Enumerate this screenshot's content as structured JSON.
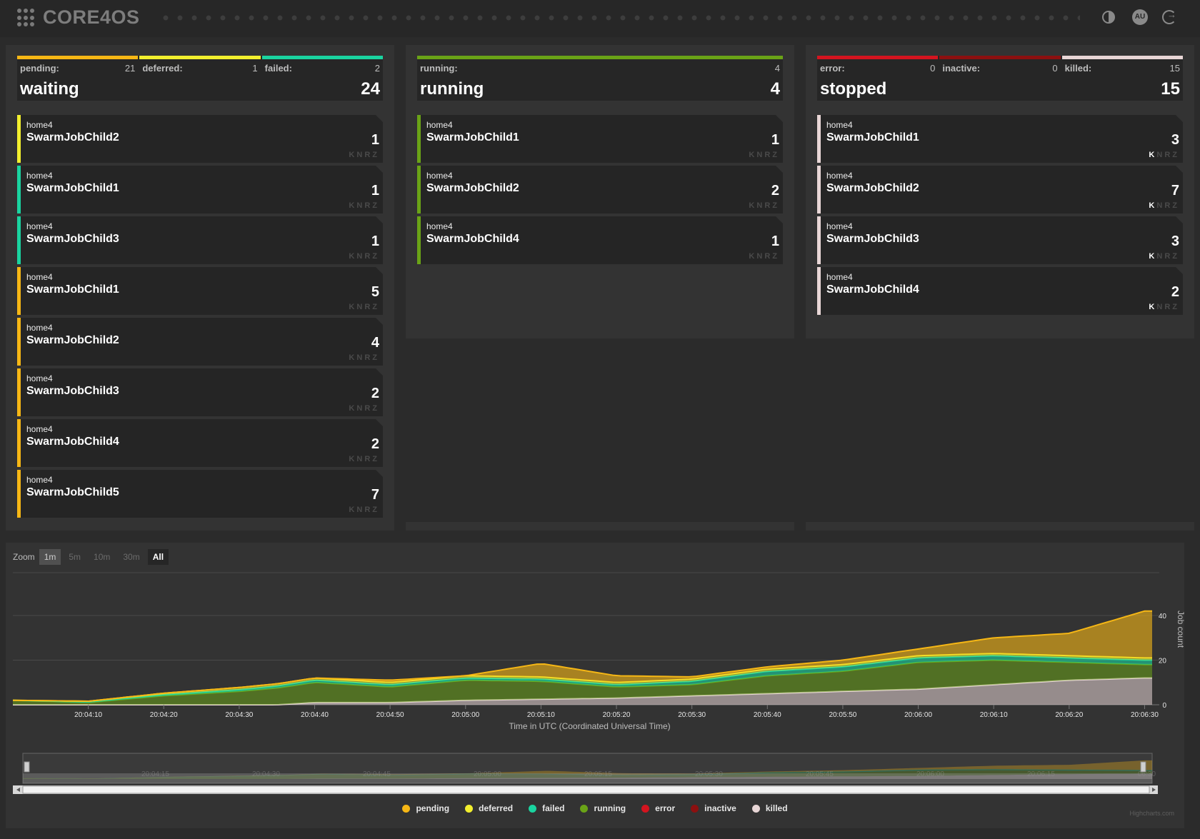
{
  "header": {
    "logo": "CORE4OS",
    "avatar_initials": "AU"
  },
  "panels": {
    "waiting": {
      "label": "waiting",
      "total": "24",
      "subs": [
        {
          "name": "pending:",
          "count": "21",
          "color": "#f6b715"
        },
        {
          "name": "deferred:",
          "count": "1",
          "color": "#f2ef2e"
        },
        {
          "name": "failed:",
          "count": "2",
          "color": "#1ad4a0"
        }
      ],
      "jobs": [
        {
          "host": "home4",
          "name": "SwarmJobChild2",
          "count": "1",
          "color": "#f2ef2e",
          "flags": [
            "K",
            "N",
            "R",
            "Z"
          ],
          "killed": false
        },
        {
          "host": "home4",
          "name": "SwarmJobChild1",
          "count": "1",
          "color": "#1ad4a0",
          "flags": [
            "K",
            "N",
            "R",
            "Z"
          ],
          "killed": false
        },
        {
          "host": "home4",
          "name": "SwarmJobChild3",
          "count": "1",
          "color": "#1ad4a0",
          "flags": [
            "K",
            "N",
            "R",
            "Z"
          ],
          "killed": false
        },
        {
          "host": "home4",
          "name": "SwarmJobChild1",
          "count": "5",
          "color": "#f6b715",
          "flags": [
            "K",
            "N",
            "R",
            "Z"
          ],
          "killed": false
        },
        {
          "host": "home4",
          "name": "SwarmJobChild2",
          "count": "4",
          "color": "#f6b715",
          "flags": [
            "K",
            "N",
            "R",
            "Z"
          ],
          "killed": false
        },
        {
          "host": "home4",
          "name": "SwarmJobChild3",
          "count": "2",
          "color": "#f6b715",
          "flags": [
            "K",
            "N",
            "R",
            "Z"
          ],
          "killed": false
        },
        {
          "host": "home4",
          "name": "SwarmJobChild4",
          "count": "2",
          "color": "#f6b715",
          "flags": [
            "K",
            "N",
            "R",
            "Z"
          ],
          "killed": false
        },
        {
          "host": "home4",
          "name": "SwarmJobChild5",
          "count": "7",
          "color": "#f6b715",
          "flags": [
            "K",
            "N",
            "R",
            "Z"
          ],
          "killed": false
        }
      ]
    },
    "running": {
      "label": "running",
      "total": "4",
      "subs": [
        {
          "name": "running:",
          "count": "4",
          "color": "#6aa317"
        }
      ],
      "jobs": [
        {
          "host": "home4",
          "name": "SwarmJobChild1",
          "count": "1",
          "color": "#6aa317",
          "flags": [
            "K",
            "N",
            "R",
            "Z"
          ],
          "killed": false
        },
        {
          "host": "home4",
          "name": "SwarmJobChild2",
          "count": "2",
          "color": "#6aa317",
          "flags": [
            "K",
            "N",
            "R",
            "Z"
          ],
          "killed": false
        },
        {
          "host": "home4",
          "name": "SwarmJobChild4",
          "count": "1",
          "color": "#6aa317",
          "flags": [
            "K",
            "N",
            "R",
            "Z"
          ],
          "killed": false
        }
      ]
    },
    "stopped": {
      "label": "stopped",
      "total": "15",
      "subs": [
        {
          "name": "error:",
          "count": "0",
          "color": "#d4141f"
        },
        {
          "name": "inactive:",
          "count": "0",
          "color": "#8c1010"
        },
        {
          "name": "killed:",
          "count": "15",
          "color": "#e8d6d6"
        }
      ],
      "jobs": [
        {
          "host": "home4",
          "name": "SwarmJobChild1",
          "count": "3",
          "color": "#e8d6d6",
          "flags": [
            "K",
            "N",
            "R",
            "Z"
          ],
          "killed": true
        },
        {
          "host": "home4",
          "name": "SwarmJobChild2",
          "count": "7",
          "color": "#e8d6d6",
          "flags": [
            "K",
            "N",
            "R",
            "Z"
          ],
          "killed": true
        },
        {
          "host": "home4",
          "name": "SwarmJobChild3",
          "count": "3",
          "color": "#e8d6d6",
          "flags": [
            "K",
            "N",
            "R",
            "Z"
          ],
          "killed": true
        },
        {
          "host": "home4",
          "name": "SwarmJobChild4",
          "count": "2",
          "color": "#e8d6d6",
          "flags": [
            "K",
            "N",
            "R",
            "Z"
          ],
          "killed": true
        }
      ]
    }
  },
  "chart": {
    "zoom_label": "Zoom",
    "zoom_buttons": [
      "1m",
      "5m",
      "10m",
      "30m",
      "All"
    ],
    "credits": "Highcharts.com"
  },
  "chart_data": {
    "type": "area",
    "stacked": true,
    "xlabel": "Time in UTC (Coordinated Universal Time)",
    "ylabel": "Job count",
    "ylim": [
      0,
      40
    ],
    "y_ticks": [
      "0",
      "20",
      "40"
    ],
    "x_ticks": [
      "20:04:10",
      "20:04:20",
      "20:04:30",
      "20:04:40",
      "20:04:50",
      "20:05:00",
      "20:05:10",
      "20:05:20",
      "20:05:30",
      "20:05:40",
      "20:05:50",
      "20:06:00",
      "20:06:10",
      "20:06:20",
      "20:06:30"
    ],
    "navigator_ticks": [
      "20:04:15",
      "20:04:30",
      "20:04:45",
      "20:05:00",
      "20:05:15",
      "20:05:30",
      "20:05:45",
      "20:06:00",
      "20:06:15",
      "06:30"
    ],
    "x_range": [
      "20:04:00",
      "20:06:31"
    ],
    "legend_position": "bottom",
    "series": [
      {
        "name": "killed",
        "color": "#e8d6d6",
        "x": [
          "20:04:00",
          "20:04:35",
          "20:04:40",
          "20:04:50",
          "20:05:00",
          "20:05:20",
          "20:05:30",
          "20:05:40",
          "20:05:50",
          "20:06:00",
          "20:06:10",
          "20:06:20",
          "20:06:30"
        ],
        "values": [
          0,
          0,
          1,
          1,
          2,
          3,
          4,
          5,
          6,
          7,
          9,
          11,
          12
        ]
      },
      {
        "name": "running",
        "color": "#6aa317",
        "x": [
          "20:04:00",
          "20:04:10",
          "20:04:20",
          "20:04:30",
          "20:04:40",
          "20:04:50",
          "20:05:00",
          "20:05:10",
          "20:05:20",
          "20:05:30",
          "20:05:40",
          "20:05:50",
          "20:06:00",
          "20:06:10",
          "20:06:20",
          "20:06:30"
        ],
        "values": [
          2,
          1,
          4,
          6,
          9,
          7,
          9,
          8,
          5,
          5,
          8,
          9,
          12,
          11,
          8,
          6
        ]
      },
      {
        "name": "failed",
        "color": "#1ad4a0",
        "x": [
          "20:04:00",
          "20:04:40",
          "20:05:00",
          "20:05:20",
          "20:05:40",
          "20:06:00",
          "20:06:20",
          "20:06:30"
        ],
        "values": [
          0,
          1,
          1,
          1,
          2,
          2,
          2,
          2
        ]
      },
      {
        "name": "deferred",
        "color": "#f2ef2e",
        "x": [
          "20:04:00",
          "20:04:30",
          "20:05:00",
          "20:05:30",
          "20:06:00",
          "20:06:30"
        ],
        "values": [
          0,
          1,
          1,
          1,
          1,
          1
        ]
      },
      {
        "name": "pending",
        "color": "#f6b715",
        "x": [
          "20:04:00",
          "20:04:10",
          "20:04:20",
          "20:04:30",
          "20:04:40",
          "20:04:50",
          "20:05:00",
          "20:05:10",
          "20:05:20",
          "20:05:30",
          "20:05:40",
          "20:05:50",
          "20:06:00",
          "20:06:10",
          "20:06:20",
          "20:06:30"
        ],
        "values": [
          0,
          0,
          0,
          0,
          0,
          1,
          0,
          6,
          3,
          1,
          1,
          2,
          3,
          7,
          10,
          21
        ]
      },
      {
        "name": "error",
        "color": "#d4141f",
        "x": [
          "20:04:00",
          "20:06:30"
        ],
        "values": [
          0,
          0
        ]
      },
      {
        "name": "inactive",
        "color": "#8c1010",
        "x": [
          "20:04:00",
          "20:06:30"
        ],
        "values": [
          0,
          0
        ]
      }
    ],
    "legend": [
      "pending",
      "deferred",
      "failed",
      "running",
      "error",
      "inactive",
      "killed"
    ]
  }
}
